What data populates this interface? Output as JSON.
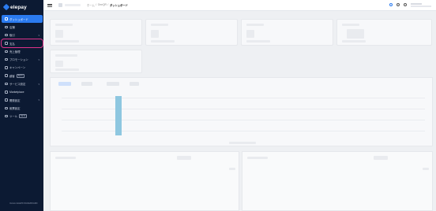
{
  "brand": {
    "name": "elepay"
  },
  "sidebar": {
    "items": [
      {
        "label": "ダッシュボード",
        "icon": "dashboard-icon",
        "active": true,
        "expandable": false
      },
      {
        "label": "店舗",
        "icon": "store-icon",
        "active": false,
        "expandable": false
      },
      {
        "label": "取引",
        "icon": "transaction-icon",
        "active": false,
        "expandable": true
      },
      {
        "label": "支払",
        "icon": "payment-icon",
        "active": false,
        "expandable": false,
        "highlight": true
      },
      {
        "label": "売上管理",
        "icon": "sales-icon",
        "active": false,
        "expandable": false
      },
      {
        "label": "プロモーション",
        "icon": "promotion-icon",
        "active": false,
        "expandable": true
      },
      {
        "label": "キャンペーン",
        "icon": "campaign-icon",
        "active": false,
        "expandable": false
      },
      {
        "label": "顧客",
        "icon": "customer-icon",
        "active": false,
        "expandable": false,
        "badge": "BETA"
      },
      {
        "label": "サービス設定",
        "icon": "service-settings-icon",
        "active": false,
        "expandable": true
      },
      {
        "label": "Marketplace",
        "icon": "marketplace-icon",
        "active": false,
        "expandable": false
      },
      {
        "label": "開発設定",
        "icon": "developer-settings-icon",
        "active": false,
        "expandable": true
      },
      {
        "label": "帳票設定",
        "icon": "report-settings-icon",
        "active": false,
        "expandable": false
      },
      {
        "label": "ツール",
        "icon": "tools-icon",
        "active": false,
        "expandable": false,
        "badge": "BETA"
      }
    ],
    "footer": "Version ELEPAYDASHBOARD"
  },
  "header": {
    "breadcrumb": [
      "ホーム",
      "OneQR",
      "ダッシュボード"
    ]
  },
  "chart_data": {
    "type": "bar",
    "categories": [],
    "values": [],
    "title": "",
    "xlabel": "",
    "ylabel": ""
  },
  "colors": {
    "sidebar_bg": "#0c1a33",
    "accent": "#2b7bf0",
    "highlight_ring": "#e0338a",
    "bar": "#8ec7e0"
  }
}
